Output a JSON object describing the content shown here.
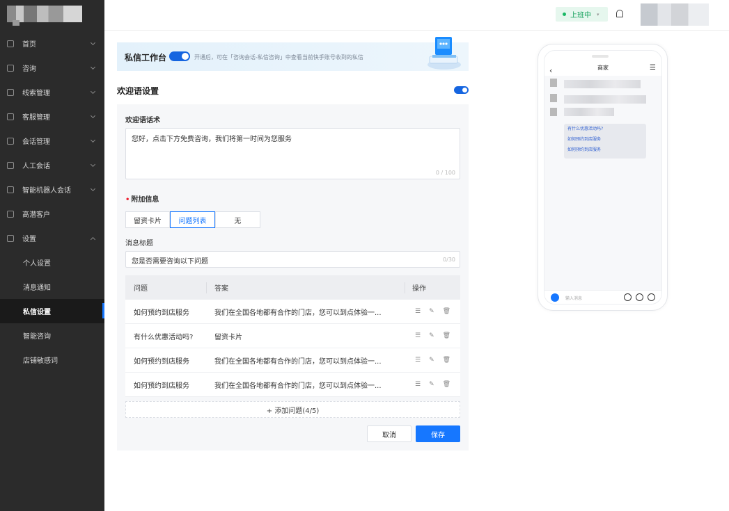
{
  "sidebar": {
    "items": [
      {
        "label": "首页"
      },
      {
        "label": "咨询"
      },
      {
        "label": "线索管理"
      },
      {
        "label": "客服管理"
      },
      {
        "label": "会话管理"
      },
      {
        "label": "人工会话"
      },
      {
        "label": "智能机器人会话"
      },
      {
        "label": "高潜客户"
      },
      {
        "label": "设置"
      }
    ],
    "sub_items": [
      {
        "label": "个人设置"
      },
      {
        "label": "消息通知"
      },
      {
        "label": "私信设置"
      },
      {
        "label": "智能咨询"
      },
      {
        "label": "店铺敏感词"
      }
    ],
    "active": "私信设置"
  },
  "topbar": {
    "status": "上班中"
  },
  "banner": {
    "title": "私信工作台",
    "desc": "开通后，可在「咨询会话-私信咨询」中查看当前快手账号收到的私信"
  },
  "welcome": {
    "title": "欢迎语设置",
    "script_label": "欢迎语话术",
    "script_value": "您好，点击下方免费咨询，我们将第一时间为您服务",
    "script_count": "0 / 100",
    "extra_label": "附加信息",
    "options": [
      "留资卡片",
      "问题列表",
      "无"
    ],
    "selected": "问题列表",
    "msg_title_label": "消息标题",
    "msg_title_value": "您是否需要咨询以下问题",
    "msg_title_count": "0/30"
  },
  "table": {
    "headers": [
      "问题",
      "答案",
      "操作"
    ],
    "rows": [
      {
        "q": "如何预约到店服务",
        "a": "我们在全国各地都有合作的门店，您可以到点体验一..."
      },
      {
        "q": "有什么优惠活动吗?",
        "a": "留资卡片"
      },
      {
        "q": "如何预约到店服务",
        "a": "我们在全国各地都有合作的门店，您可以到点体验一..."
      },
      {
        "q": "如何预约到店服务",
        "a": "我们在全国各地都有合作的门店，您可以到点体验一..."
      }
    ],
    "add_label": "+ 添加问题(4/5)"
  },
  "actions": {
    "cancel": "取消",
    "save": "保存"
  },
  "phone": {
    "title": "商家",
    "questions": [
      "有什么优惠活动吗?",
      "如何预约到店服务",
      "如何预约到店服务"
    ],
    "input_placeholder": "输入消息"
  },
  "colors": {
    "accent": "#1677ff",
    "sidebar_bg": "#2b2b2b",
    "status_green": "#19b865"
  }
}
